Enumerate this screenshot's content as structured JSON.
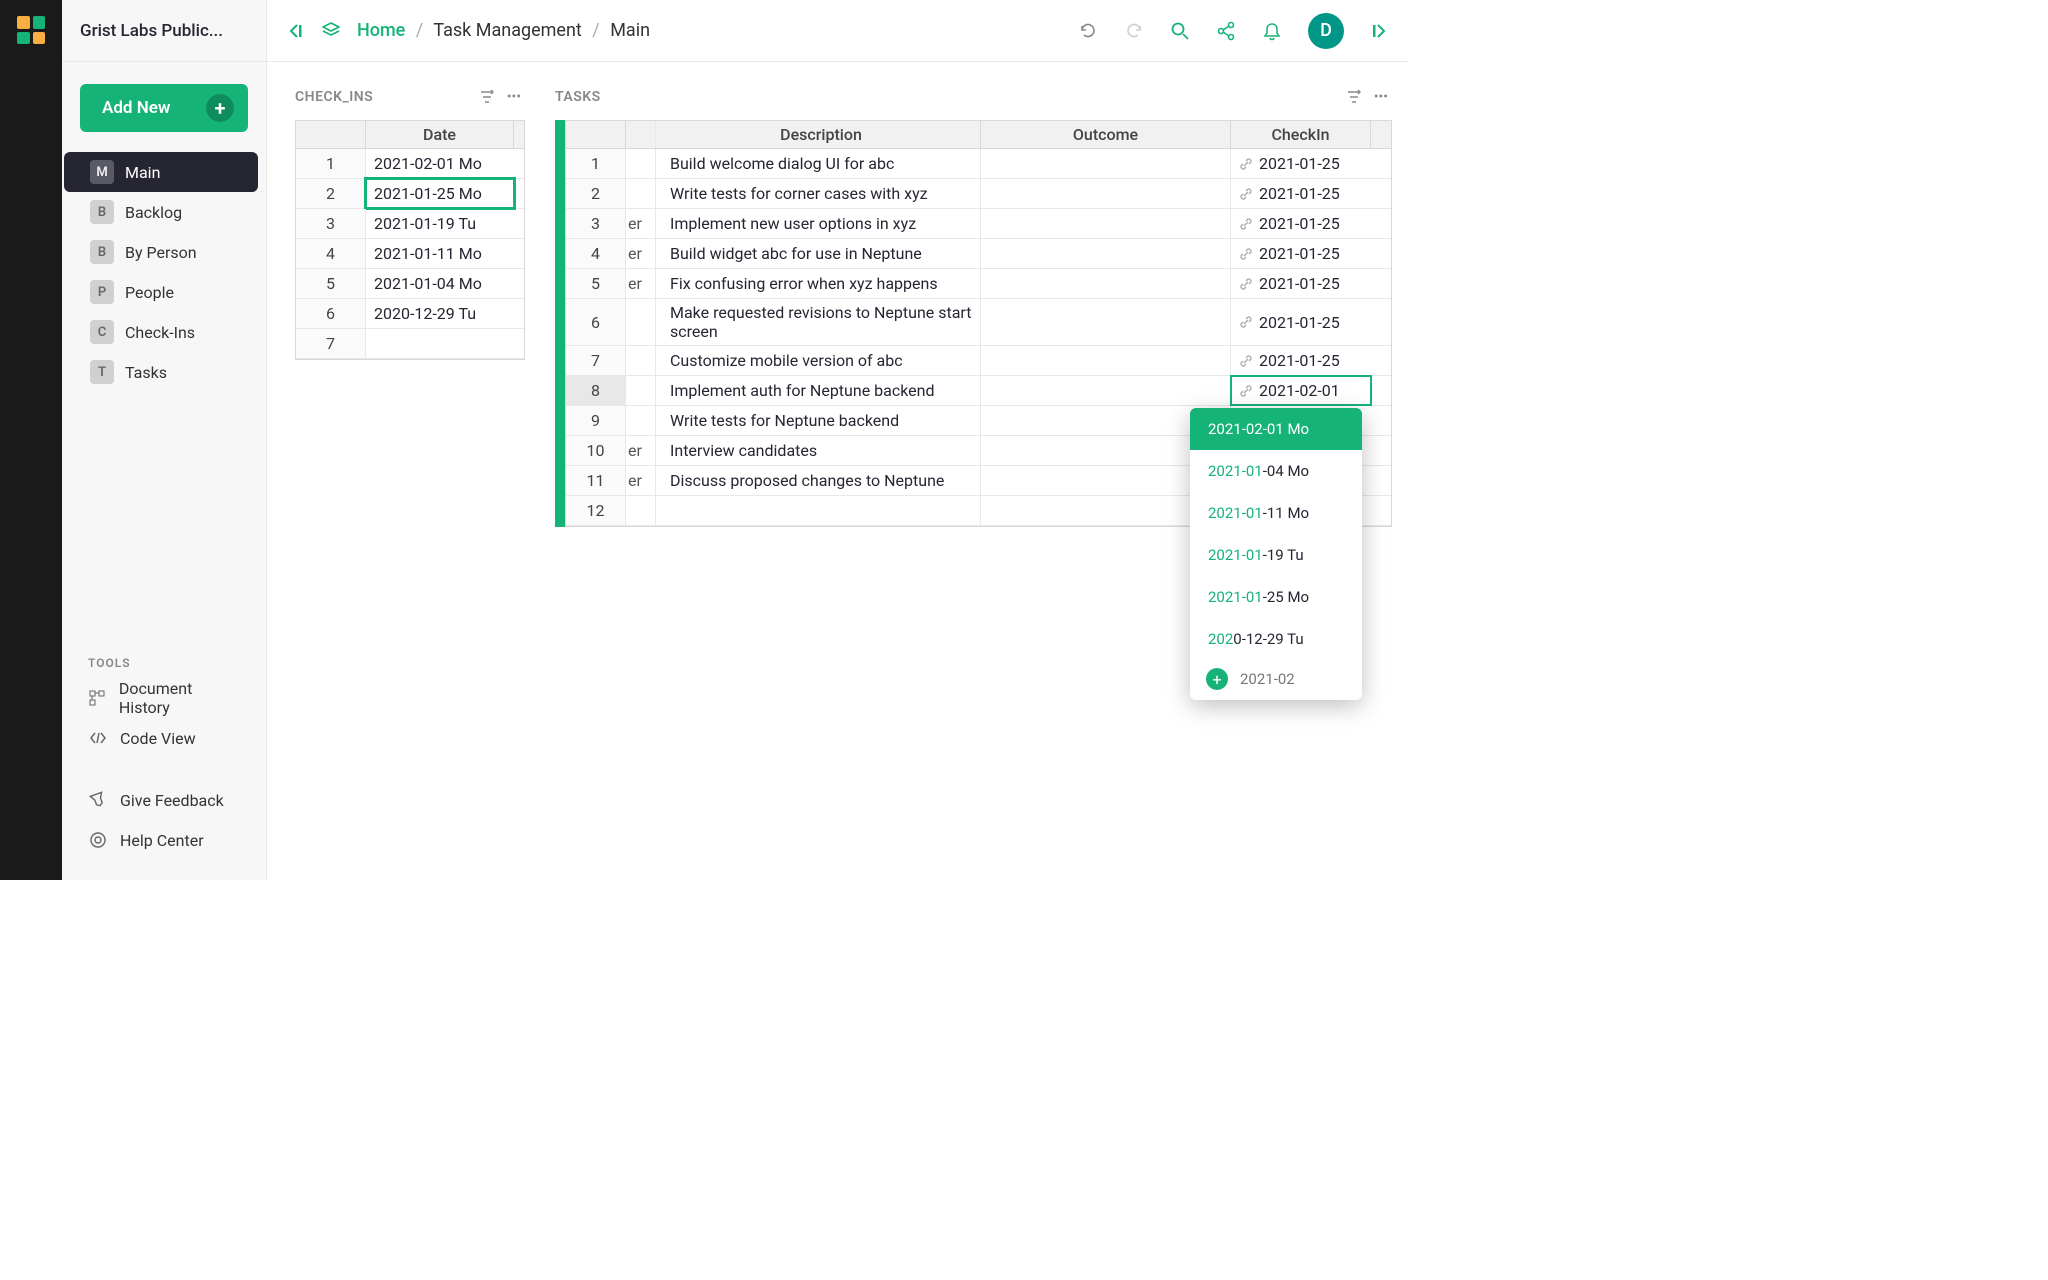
{
  "workspace": "Grist Labs Public...",
  "addNewLabel": "Add New",
  "pages": [
    {
      "badge": "M",
      "label": "Main",
      "active": true
    },
    {
      "badge": "B",
      "label": "Backlog"
    },
    {
      "badge": "B",
      "label": "By Person"
    },
    {
      "badge": "P",
      "label": "People"
    },
    {
      "badge": "C",
      "label": "Check-Ins"
    },
    {
      "badge": "T",
      "label": "Tasks"
    }
  ],
  "toolsLabel": "TOOLS",
  "tools": [
    {
      "label": "Document History"
    },
    {
      "label": "Code View"
    },
    {
      "label": "Give Feedback"
    },
    {
      "label": "Help Center"
    }
  ],
  "breadcrumb": {
    "home": "Home",
    "doc": "Task Management",
    "page": "Main"
  },
  "avatar": "D",
  "checkinsPanel": {
    "title": "CHECK_INS",
    "header": "Date",
    "rows": [
      {
        "n": "1",
        "date": "2021-02-01 Mo"
      },
      {
        "n": "2",
        "date": "2021-01-25 Mo",
        "highlight": true
      },
      {
        "n": "3",
        "date": "2021-01-19 Tu"
      },
      {
        "n": "4",
        "date": "2021-01-11 Mo"
      },
      {
        "n": "5",
        "date": "2021-01-04 Mo"
      },
      {
        "n": "6",
        "date": "2020-12-29 Tu"
      },
      {
        "n": "7",
        "date": ""
      }
    ]
  },
  "tasksPanel": {
    "title": "TASKS",
    "headers": {
      "desc": "Description",
      "outcome": "Outcome",
      "checkin": "CheckIn"
    },
    "rows": [
      {
        "n": "1",
        "who": "",
        "desc": "Build welcome dialog UI for abc",
        "outcome": "",
        "checkin": "2021-01-25"
      },
      {
        "n": "2",
        "who": "",
        "desc": "Write tests for corner cases with xyz",
        "outcome": "",
        "checkin": "2021-01-25"
      },
      {
        "n": "3",
        "who": "er",
        "desc": "Implement new user options in xyz",
        "outcome": "",
        "checkin": "2021-01-25"
      },
      {
        "n": "4",
        "who": "er",
        "desc": "Build widget abc for use in Neptune",
        "outcome": "",
        "checkin": "2021-01-25"
      },
      {
        "n": "5",
        "who": "er",
        "desc": "Fix confusing error when xyz happens",
        "outcome": "",
        "checkin": "2021-01-25"
      },
      {
        "n": "6",
        "who": "",
        "desc": "Make requested revisions to Neptune start screen",
        "outcome": "",
        "checkin": "2021-01-25"
      },
      {
        "n": "7",
        "who": "",
        "desc": "Customize mobile version of abc",
        "outcome": "",
        "checkin": "2021-01-25"
      },
      {
        "n": "8",
        "who": "",
        "desc": "Implement auth for Neptune backend",
        "outcome": "",
        "checkin": "2021-02-01",
        "selected": true
      },
      {
        "n": "9",
        "who": "",
        "desc": "Write tests for Neptune backend",
        "outcome": "",
        "checkin": ""
      },
      {
        "n": "10",
        "who": "er",
        "desc": "Interview candidates",
        "outcome": "",
        "checkin": ""
      },
      {
        "n": "11",
        "who": "er",
        "desc": "Discuss proposed changes to Neptune",
        "outcome": "",
        "checkin": ""
      },
      {
        "n": "12",
        "who": "",
        "desc": "",
        "outcome": "",
        "checkin": ""
      }
    ]
  },
  "dropdown": {
    "items": [
      {
        "text": "2021-02-01 Mo",
        "sel": true,
        "hl": 7
      },
      {
        "text": "2021-01-04 Mo",
        "hl": 7
      },
      {
        "text": "2021-01-11 Mo",
        "hl": 7
      },
      {
        "text": "2021-01-19 Tu",
        "hl": 7
      },
      {
        "text": "2021-01-25 Mo",
        "hl": 7
      },
      {
        "text": "2020-12-29 Tu",
        "hl": 3
      }
    ],
    "addValue": "2021-02"
  }
}
